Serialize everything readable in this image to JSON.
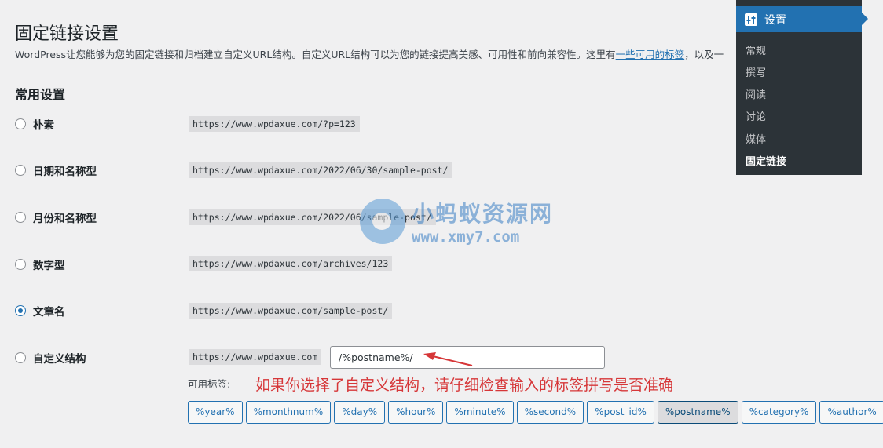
{
  "page": {
    "title": "固定链接设置",
    "intro_before": "WordPress让您能够为您的固定链接和归档建立自定义URL结构。自定义URL结构可以为您的链接提高美感、可用性和前向兼容性。这里有",
    "intro_link": "一些可用的标签",
    "intro_after": "，以及一",
    "section_title": "常用设置"
  },
  "options": [
    {
      "label": "朴素",
      "url": "https://www.wpdaxue.com/?p=123",
      "checked": false
    },
    {
      "label": "日期和名称型",
      "url": "https://www.wpdaxue.com/2022/06/30/sample-post/",
      "checked": false
    },
    {
      "label": "月份和名称型",
      "url": "https://www.wpdaxue.com/2022/06/sample-post/",
      "checked": false
    },
    {
      "label": "数字型",
      "url": "https://www.wpdaxue.com/archives/123",
      "checked": false
    },
    {
      "label": "文章名",
      "url": "https://www.wpdaxue.com/sample-post/",
      "checked": true
    },
    {
      "label": "自定义结构",
      "url": "https://www.wpdaxue.com",
      "checked": false
    }
  ],
  "custom_structure": {
    "value": "/%postname%/",
    "tags_label": "可用标签:",
    "annotation": "如果你选择了自定义结构，请仔细检查输入的标签拼写是否准确"
  },
  "tags": [
    "%year%",
    "%monthnum%",
    "%day%",
    "%hour%",
    "%minute%",
    "%second%",
    "%post_id%",
    "%postname%",
    "%category%",
    "%author%"
  ],
  "active_tag": "%postname%",
  "watermark": {
    "cn": "小蚂蚁资源网",
    "url": "www.xmy7.com"
  },
  "submenu": {
    "header": "设置",
    "header_icon": "settings-sliders-icon",
    "items": [
      {
        "label": "常规",
        "current": false
      },
      {
        "label": "撰写",
        "current": false
      },
      {
        "label": "阅读",
        "current": false
      },
      {
        "label": "讨论",
        "current": false
      },
      {
        "label": "媒体",
        "current": false
      },
      {
        "label": "固定链接",
        "current": true
      }
    ]
  },
  "colors": {
    "accent": "#2271b1",
    "annotation": "#d63638",
    "menu_bg": "#2c3338"
  }
}
